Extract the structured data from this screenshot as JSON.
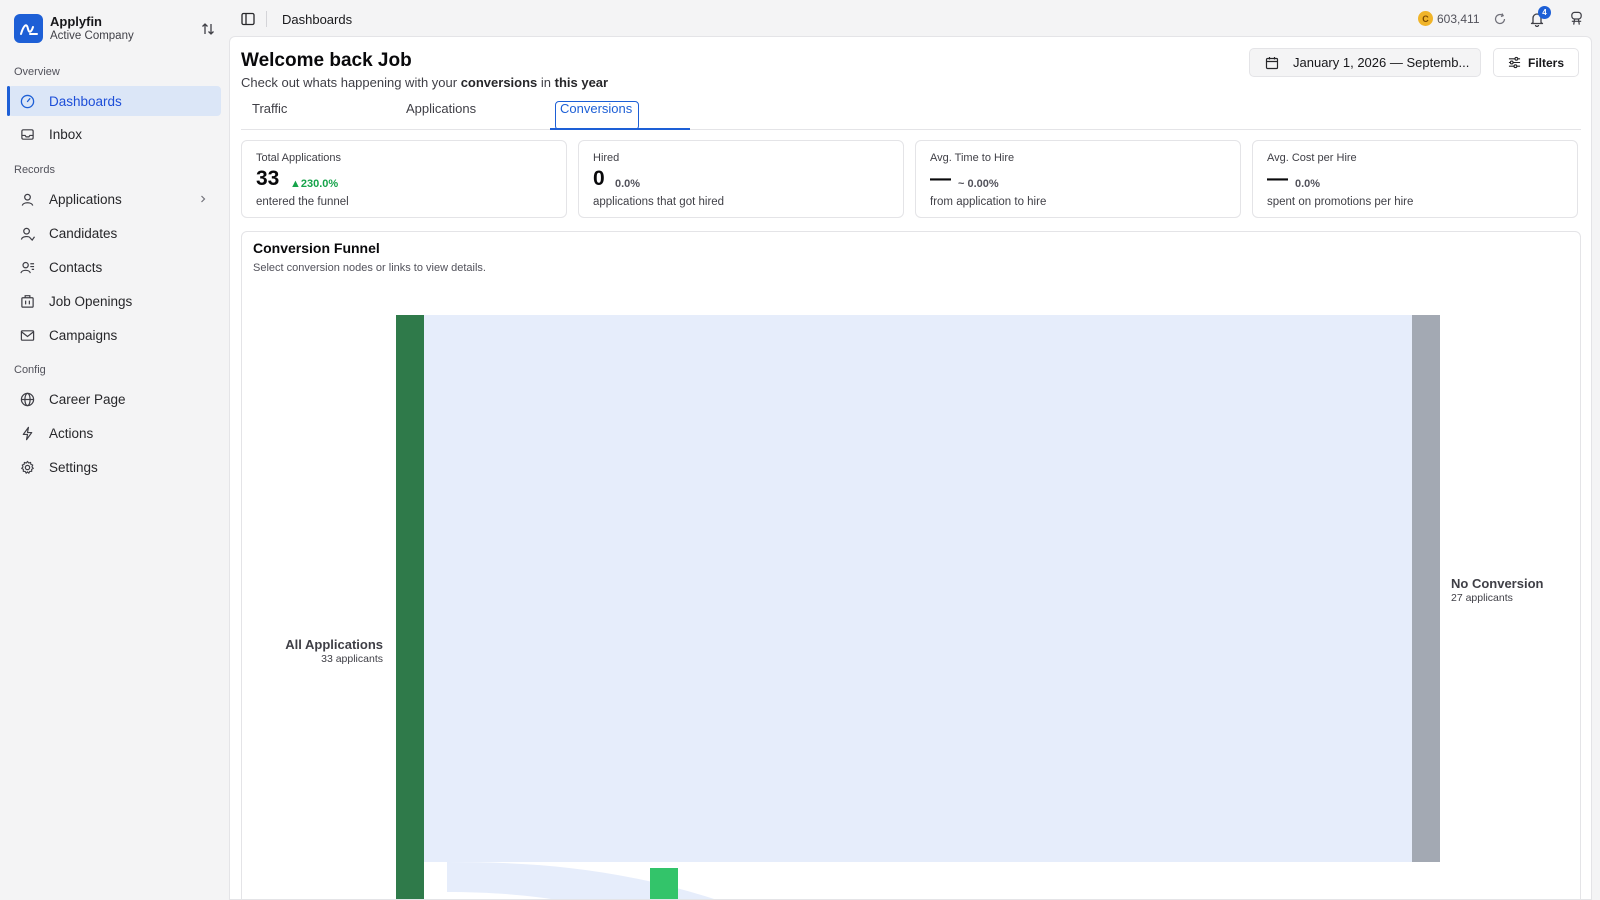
{
  "brand": {
    "name": "Applyfin",
    "company": "Active Company"
  },
  "sidebar": {
    "sections": [
      "Overview",
      "Records",
      "Config"
    ],
    "items": [
      {
        "label": "Dashboards",
        "icon": "gauge-icon",
        "active": true
      },
      {
        "label": "Inbox",
        "icon": "inbox-icon"
      },
      {
        "label": "Applications",
        "icon": "user-icon"
      },
      {
        "label": "Candidates",
        "icon": "candidate-icon"
      },
      {
        "label": "Contacts",
        "icon": "contacts-icon"
      },
      {
        "label": "Job Openings",
        "icon": "briefcase-icon"
      },
      {
        "label": "Campaigns",
        "icon": "mail-icon"
      },
      {
        "label": "Career Page",
        "icon": "globe-icon"
      },
      {
        "label": "Actions",
        "icon": "bolt-icon"
      },
      {
        "label": "Settings",
        "icon": "gear-icon"
      }
    ]
  },
  "topbar": {
    "breadcrumb": "Dashboards",
    "credits_symbol": "C",
    "credits": "603,411",
    "notifications": "4"
  },
  "header": {
    "title": "Welcome back Job",
    "subtitle_pre": "Check out whats happening with your ",
    "subtitle_topic": "conversions",
    "subtitle_mid": " in ",
    "subtitle_period": "this year",
    "date_range": "January 1, 2026 — Septemb...",
    "filters_label": "Filters"
  },
  "tabs": [
    "Traffic",
    "Applications",
    "Conversions"
  ],
  "kpis": [
    {
      "label": "Total Applications",
      "value": "33",
      "delta": "▲230.0%",
      "desc": "entered the funnel"
    },
    {
      "label": "Hired",
      "value": "0",
      "delta": "0.0%",
      "desc": "applications that got hired"
    },
    {
      "label": "Avg. Time to Hire",
      "value": "—",
      "delta": "~ 0.00%",
      "desc": "from application to hire"
    },
    {
      "label": "Avg. Cost per Hire",
      "value": "—",
      "delta": "0.0%",
      "desc": "spent on promotions per hire"
    }
  ],
  "funnel": {
    "title": "Conversion Funnel",
    "subtitle": "Select conversion nodes or links to view details.",
    "nodes": [
      {
        "name": "All Applications",
        "detail": "33 applicants",
        "count": 33,
        "color": "#2f7a4a"
      },
      {
        "name": "No Conversion",
        "detail": "27 applicants",
        "count": 27,
        "color": "#a3a9b3"
      }
    ],
    "colors": {
      "link": "#e6edfb",
      "secondary_node": "#33c46a"
    }
  }
}
